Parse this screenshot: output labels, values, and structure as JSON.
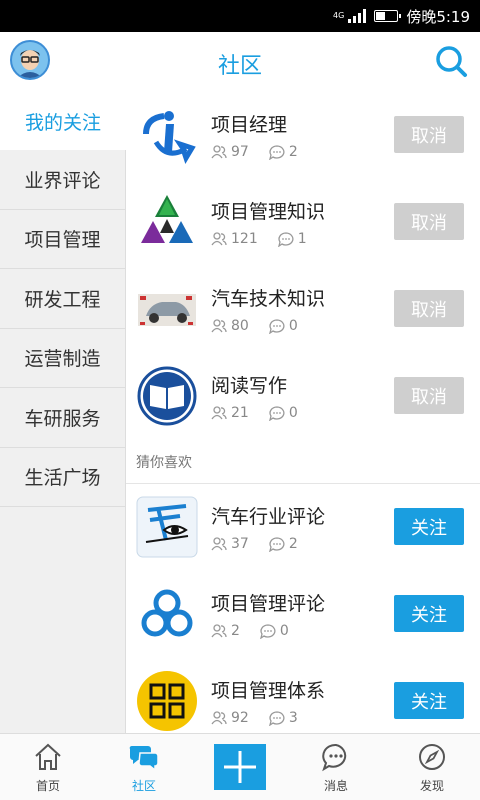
{
  "status_bar": {
    "network": "4G",
    "time_label": "傍晚5:19",
    "battery_level": 0.45
  },
  "header": {
    "title": "社区",
    "avatar_icon": "avatar-icon",
    "search_icon": "search-icon"
  },
  "sidebar": {
    "items": [
      {
        "label": "我的关注",
        "active": true
      },
      {
        "label": "业界评论",
        "active": false
      },
      {
        "label": "项目管理",
        "active": false
      },
      {
        "label": "研发工程",
        "active": false
      },
      {
        "label": "运营制造",
        "active": false
      },
      {
        "label": "车研服务",
        "active": false
      },
      {
        "label": "生活广场",
        "active": false
      }
    ]
  },
  "followed": [
    {
      "name": "项目经理",
      "members": "97",
      "posts": "2",
      "button": "取消"
    },
    {
      "name": "项目管理知识",
      "members": "121",
      "posts": "1",
      "button": "取消"
    },
    {
      "name": "汽车技术知识",
      "members": "80",
      "posts": "0",
      "button": "取消"
    },
    {
      "name": "阅读写作",
      "members": "21",
      "posts": "0",
      "button": "取消"
    }
  ],
  "recommend_label": "猜你喜欢",
  "recommended": [
    {
      "name": "汽车行业评论",
      "members": "37",
      "posts": "2",
      "button": "关注"
    },
    {
      "name": "项目管理评论",
      "members": "2",
      "posts": "0",
      "button": "关注"
    },
    {
      "name": "项目管理体系",
      "members": "92",
      "posts": "3",
      "button": "关注"
    }
  ],
  "tabbar": {
    "tabs": [
      {
        "label": "首页",
        "icon": "home-icon"
      },
      {
        "label": "社区",
        "icon": "chat-bubbles-icon"
      },
      {
        "label": "",
        "icon": "plus-icon"
      },
      {
        "label": "消息",
        "icon": "message-icon"
      },
      {
        "label": "发现",
        "icon": "compass-icon"
      }
    ]
  },
  "colors": {
    "accent": "#1a9ee0",
    "cancel_button": "#cfcfcf",
    "sidebar_bg": "#f0f0f0"
  }
}
